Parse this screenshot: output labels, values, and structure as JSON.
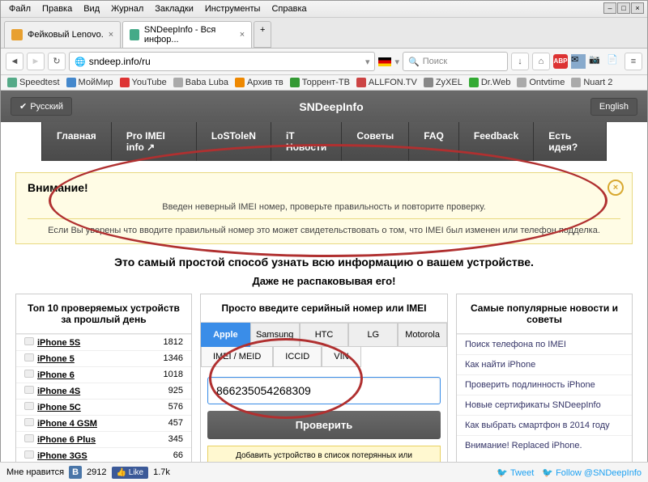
{
  "menu": [
    "Файл",
    "Правка",
    "Вид",
    "Журнал",
    "Закладки",
    "Инструменты",
    "Справка"
  ],
  "tabs": [
    {
      "title": "Фейковый Lenovo.",
      "active": false
    },
    {
      "title": "SNDeepInfo - Вся инфор...",
      "active": true
    }
  ],
  "url": "sndeep.info/ru",
  "search_placeholder": "Поиск",
  "bookmarks": [
    "Speedtest",
    "МойМир",
    "YouTube",
    "Baba Luba",
    "Архив тв",
    "Торрент-ТВ",
    "ALLFON.TV",
    "ZyXEL",
    "Dr.Web",
    "Ontvtime",
    "Nuart 2"
  ],
  "lang_left": "Русский",
  "lang_right": "English",
  "site_title": "SNDeepInfo",
  "nav": [
    "Главная",
    "Pro IMEI info",
    "LoSToleN",
    "iT Новости",
    "Советы",
    "FAQ",
    "Feedback",
    "Есть идея?"
  ],
  "alert": {
    "title": "Внимание!",
    "line1": "Введен неверный IMEI номер, проверьте правильность и повторите проверку.",
    "line2": "Если Вы уверены что вводите правильный номер это может свидетельствовать о том, что IMEI был изменен или телефон подделка."
  },
  "tagline1": "Это самый простой способ узнать всю информацию о вашем устройстве.",
  "tagline2": "Даже не распаковывая его!",
  "top10_title": "Топ 10 проверяемых устройств за прошлый день",
  "top10": [
    {
      "name": "iPhone 5S",
      "count": 1812
    },
    {
      "name": "iPhone 5",
      "count": 1346
    },
    {
      "name": "iPhone 6",
      "count": 1018
    },
    {
      "name": "iPhone 4S",
      "count": 925
    },
    {
      "name": "iPhone 5C",
      "count": 576
    },
    {
      "name": "iPhone 4 GSM",
      "count": 457
    },
    {
      "name": "iPhone 6 Plus",
      "count": 345
    },
    {
      "name": "iPhone 3GS",
      "count": 66
    }
  ],
  "mid_title": "Просто введите серийный номер или IMEI",
  "brands": [
    "Apple",
    "Samsung",
    "HTC",
    "LG",
    "Motorola"
  ],
  "subtabs": [
    "IMEI / MEID",
    "ICCID",
    "VIN"
  ],
  "imei_value": "866235054268309",
  "check_btn": "Проверить",
  "add_lost": "Добавить устройство в список потерянных или украденных",
  "news_title": "Самые популярные новости и советы",
  "news": [
    "Поиск телефона по IMEI",
    "Как найти iPhone",
    "Проверить подлинность iPhone",
    "Новые сертификаты SNDeepInfo",
    "Как выбрать смартфон в 2014 году",
    "Внимание! Replaced iPhone."
  ],
  "footer": {
    "like": "Мне нравится",
    "vk_count": "2912",
    "fb": "Like",
    "fb_count": "1.7k",
    "tweet": "Tweet",
    "follow": "Follow @SNDeepInfo"
  }
}
